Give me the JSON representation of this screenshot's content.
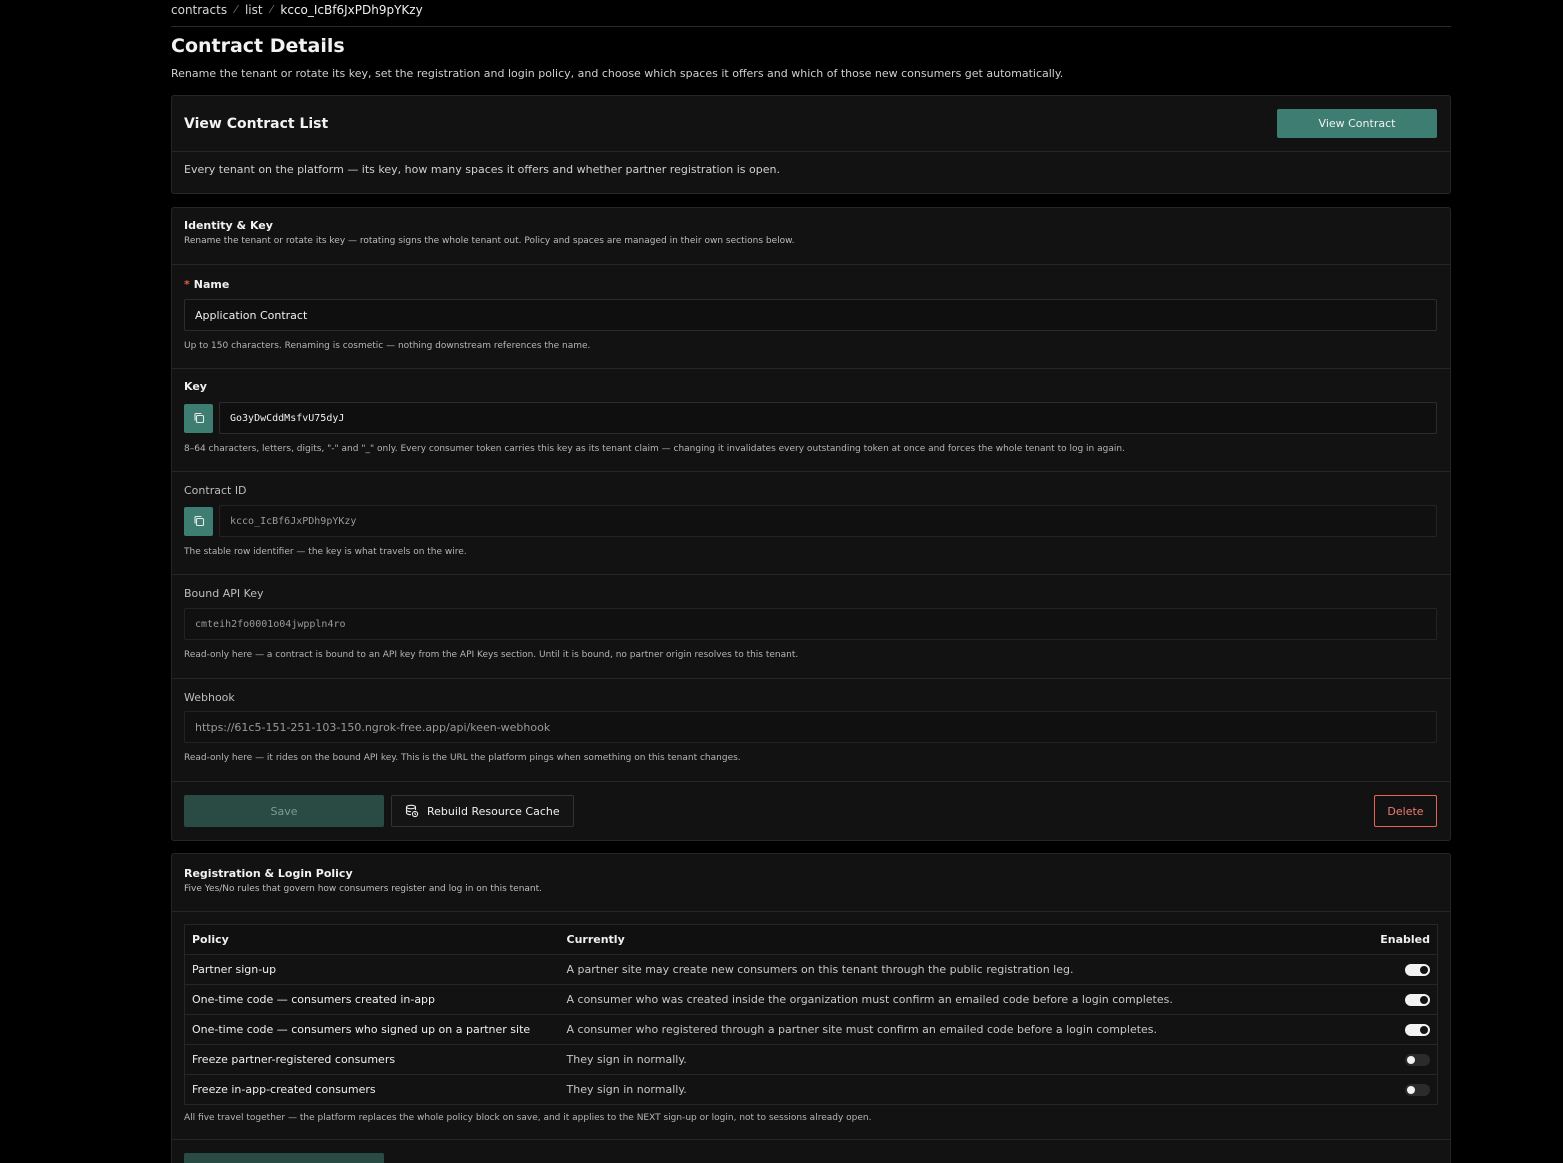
{
  "breadcrumb": {
    "items": [
      "contracts",
      "list"
    ],
    "current": "kcco_IcBf6JxPDh9pYKzy",
    "separator": "⁄"
  },
  "page": {
    "title": "Contract Details",
    "description": "Rename the tenant or rotate its key, set the registration and login policy, and choose which spaces it offers and which of those new consumers get automatically."
  },
  "list_card": {
    "title": "View Contract List",
    "button_label": "View Contract",
    "description": "Every tenant on the platform — its key, how many spaces it offers and whether partner registration is open."
  },
  "identity": {
    "title": "Identity & Key",
    "subtitle": "Rename the tenant or rotate its key — rotating signs the whole tenant out. Policy and spaces are managed in their own sections below.",
    "name": {
      "required_mark": "*",
      "label": "Name",
      "value": "Application Contract",
      "help": "Up to 150 characters. Renaming is cosmetic — nothing downstream references the name."
    },
    "key": {
      "label": "Key",
      "value": "Go3yDwCddMsfvU75dyJ",
      "help": "8–64 characters, letters, digits, \"-\" and \"_\" only. Every consumer token carries this key as its tenant claim — changing it invalidates every outstanding token at once and forces the whole tenant to log in again."
    },
    "contract_id": {
      "label": "Contract ID",
      "value": "kcco_IcBf6JxPDh9pYKzy",
      "help": "The stable row identifier — the key is what travels on the wire."
    },
    "api_key": {
      "label": "Bound API Key",
      "value": "cmteih2fo0001o04jwppln4ro",
      "help": "Read-only here — a contract is bound to an API key from the API Keys section. Until it is bound, no partner origin resolves to this tenant."
    },
    "webhook": {
      "label": "Webhook",
      "value": "https://61c5-151-251-103-150.ngrok-free.app/api/keen-webhook",
      "help": "Read-only here — it rides on the bound API key. This is the URL the platform pings when something on this tenant changes."
    },
    "actions": {
      "save": "Save",
      "rebuild": "Rebuild Resource Cache",
      "delete": "Delete"
    }
  },
  "policy": {
    "title": "Registration & Login Policy",
    "subtitle": "Five Yes/No rules that govern how consumers register and log in on this tenant.",
    "columns": {
      "policy": "Policy",
      "currently": "Currently",
      "enabled": "Enabled"
    },
    "rows": [
      {
        "policy": "Partner sign-up",
        "currently": "A partner site may create new consumers on this tenant through the public registration leg.",
        "enabled": true
      },
      {
        "policy": "One-time code — consumers created in-app",
        "currently": "A consumer who was created inside the organization must confirm an emailed code before a login completes.",
        "enabled": true
      },
      {
        "policy": "One-time code — consumers who signed up on a partner site",
        "currently": "A consumer who registered through a partner site must confirm an emailed code before a login completes.",
        "enabled": true
      },
      {
        "policy": "Freeze partner-registered consumers",
        "currently": "They sign in normally.",
        "enabled": false
      },
      {
        "policy": "Freeze in-app-created consumers",
        "currently": "They sign in normally.",
        "enabled": false
      }
    ],
    "footnote": "All five travel together — the platform replaces the whole policy block on save, and it applies to the NEXT sign-up or login, not to sessions already open."
  }
}
